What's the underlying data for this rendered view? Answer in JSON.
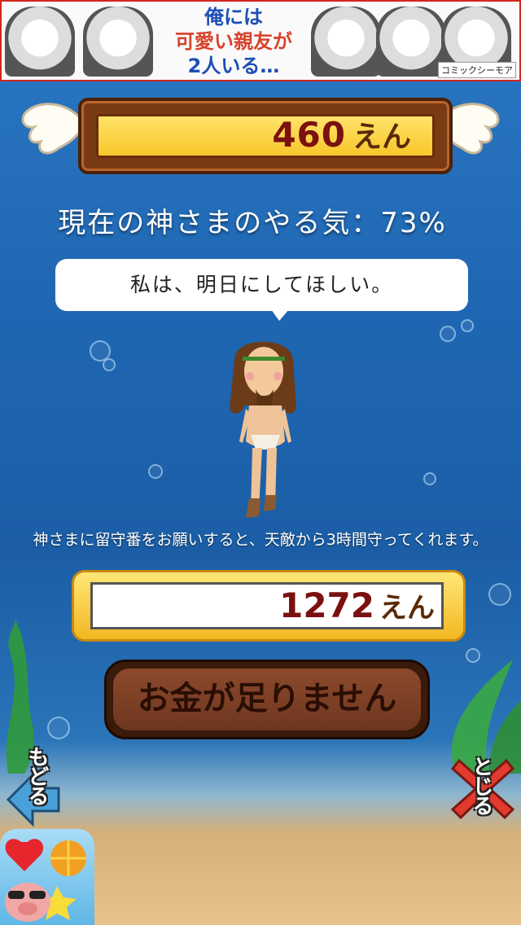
{
  "ad_banner": {
    "line1": "俺には",
    "line2": "可愛い親友が",
    "line3": "2人いる…",
    "brand": "コミックシーモア"
  },
  "money": {
    "value": "460",
    "unit": "えん"
  },
  "motivation_text": "現在の神さまのやる気：73%",
  "speech_text": "私は、明日にしてほしい。",
  "info_text": "神さまに留守番をお願いすると、天敵から3時間守ってくれます。",
  "cost": {
    "value": "1272",
    "unit": "えん"
  },
  "buy_button_label": "お金が足りません",
  "back_label": "もどる",
  "close_label": "とじる",
  "colors": {
    "money_text": "#7b1010",
    "frame_brown": "#7a3a14",
    "gold": "#f8c62a",
    "sea_blue": "#1f66b2"
  }
}
